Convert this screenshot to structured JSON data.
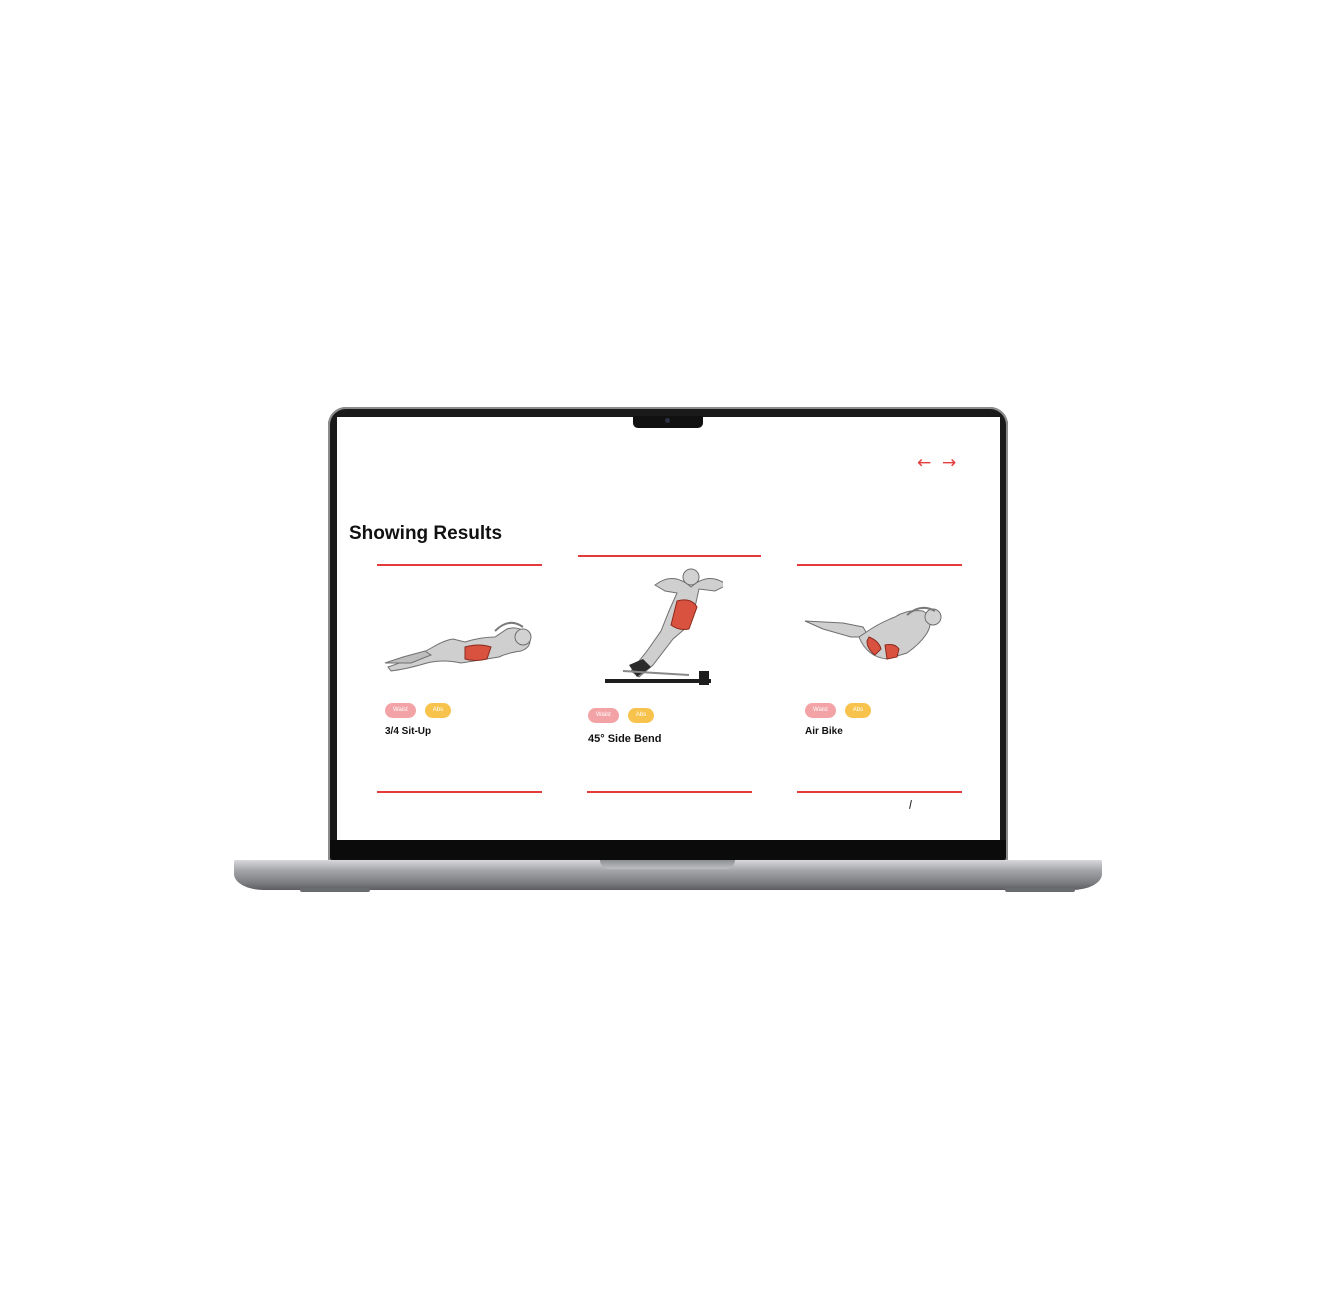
{
  "nav": {
    "prev_icon": "←",
    "next_icon": "→",
    "accent": "#e53a3a"
  },
  "section": {
    "title": "Showing Results"
  },
  "cards": [
    {
      "name": "3/4 Sit-Up",
      "tags": [
        "Waist",
        "Abs"
      ],
      "image": "sit-up-illustration"
    },
    {
      "name": "45° Side Bend",
      "tags": [
        "Waist",
        "Abs"
      ],
      "image": "side-bend-illustration"
    },
    {
      "name": "Air Bike",
      "tags": [
        "Waist",
        "Abs"
      ],
      "image": "air-bike-illustration"
    }
  ],
  "colors": {
    "tag_waist": "#f3a3a6",
    "tag_abs": "#f7c34d",
    "line": "#e33a3a"
  }
}
